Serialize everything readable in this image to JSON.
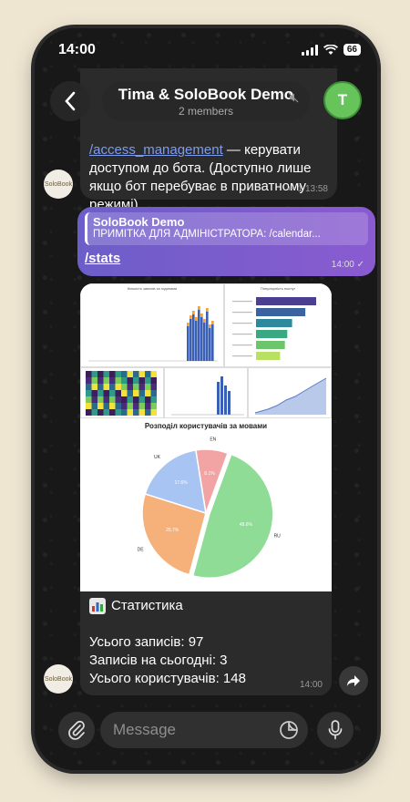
{
  "status": {
    "time": "14:00",
    "battery": "66"
  },
  "header": {
    "title": "Tima & SoloBook Demo",
    "subtitle": "2 members",
    "avatar_letter": "T"
  },
  "bot": {
    "avatar_label": "SoloBook"
  },
  "message1": {
    "command": "/access_management",
    "text": " — керувати доступом до бота. (Доступно лише якщо бот перебуває в приватному режимі)",
    "replies": "1",
    "time": "13:58"
  },
  "message2": {
    "reply_name": "SoloBook Demo",
    "reply_text": "ПРИМІТКА ДЛЯ АДМІНІСТРАТОРА: /calendar...",
    "link": "/stats",
    "time": "14:00"
  },
  "media": {
    "chart_titles": {
      "top_left": "Кількість записів за годинами",
      "top_right": "Популярність послуг",
      "pie": "Розподіл користувачів за мовами"
    },
    "caption_title": "Статистика",
    "lines": [
      "Усього записів: 97",
      "Записів на сьогодні: 3",
      "Усього користувачів: 148"
    ],
    "time": "14:00"
  },
  "composer": {
    "placeholder": "Message"
  },
  "chart_data": [
    {
      "type": "pie",
      "title": "Розподіл користувачів за мовами",
      "categories": [
        "RU",
        "DE",
        "UK",
        "EN"
      ],
      "values": [
        48.6,
        25.7,
        17.6,
        8.1
      ],
      "colors": [
        "#8fdc97",
        "#f6b07a",
        "#a8c4f2",
        "#f2a3a3"
      ]
    },
    {
      "type": "bar",
      "title": "Популярність послуг",
      "orientation": "horizontal",
      "values": [
        100,
        82,
        60,
        52,
        48,
        40
      ],
      "colors": [
        "#4b3f8f",
        "#3a63a0",
        "#2e8a9a",
        "#3aa880",
        "#6cc56a",
        "#b8e062"
      ]
    }
  ]
}
